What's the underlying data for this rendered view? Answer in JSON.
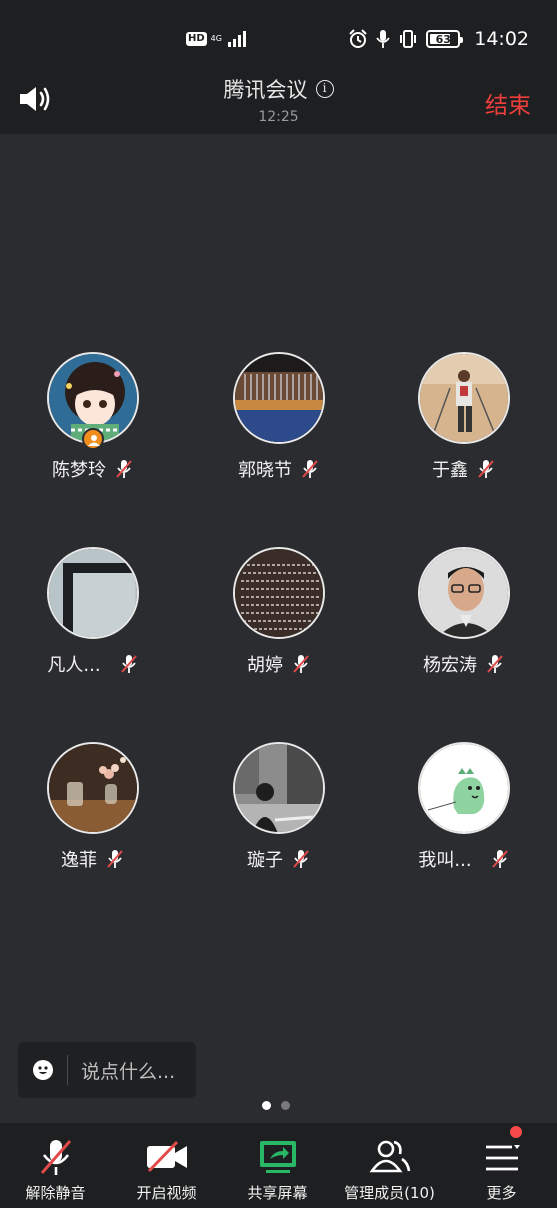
{
  "status_bar": {
    "hd": "HD",
    "network": "4G",
    "battery": "63",
    "clock": "14:02"
  },
  "header": {
    "title": "腾讯会议",
    "elapsed": "12:25",
    "end_label": "结束"
  },
  "participants": [
    {
      "name": "陈梦玲",
      "is_host": true,
      "muted": true,
      "avatar": "anime-girl"
    },
    {
      "name": "郭晓节",
      "is_host": false,
      "muted": true,
      "avatar": "loom-weaving"
    },
    {
      "name": "于鑫",
      "is_host": false,
      "muted": true,
      "avatar": "desert-hiker"
    },
    {
      "name": "凡人...",
      "is_host": false,
      "muted": true,
      "avatar": "grey-frame"
    },
    {
      "name": "胡婷",
      "is_host": false,
      "muted": true,
      "avatar": "calligraphy-text"
    },
    {
      "name": "杨宏涛",
      "is_host": false,
      "muted": true,
      "avatar": "man-glasses"
    },
    {
      "name": "逸菲",
      "is_host": false,
      "muted": true,
      "avatar": "cafe-flowers"
    },
    {
      "name": "璇子",
      "is_host": false,
      "muted": true,
      "avatar": "street-bw"
    },
    {
      "name": "我叫...",
      "is_host": false,
      "muted": true,
      "avatar": "green-dinosaur"
    }
  ],
  "chat": {
    "placeholder": "说点什么..."
  },
  "page_indicator": {
    "pages": 2,
    "current": 1
  },
  "toolbar": {
    "unmute_label": "解除静音",
    "video_label": "开启视频",
    "share_label": "共享屏幕",
    "members_label": "管理成员(10)",
    "more_label": "更多"
  },
  "colors": {
    "background": "#2b2c2f",
    "bar": "#1e1f21",
    "end_red": "#ef3f3b",
    "mute_red": "#e24a4a",
    "share_green": "#29b865",
    "host_orange": "#f08d1f"
  }
}
